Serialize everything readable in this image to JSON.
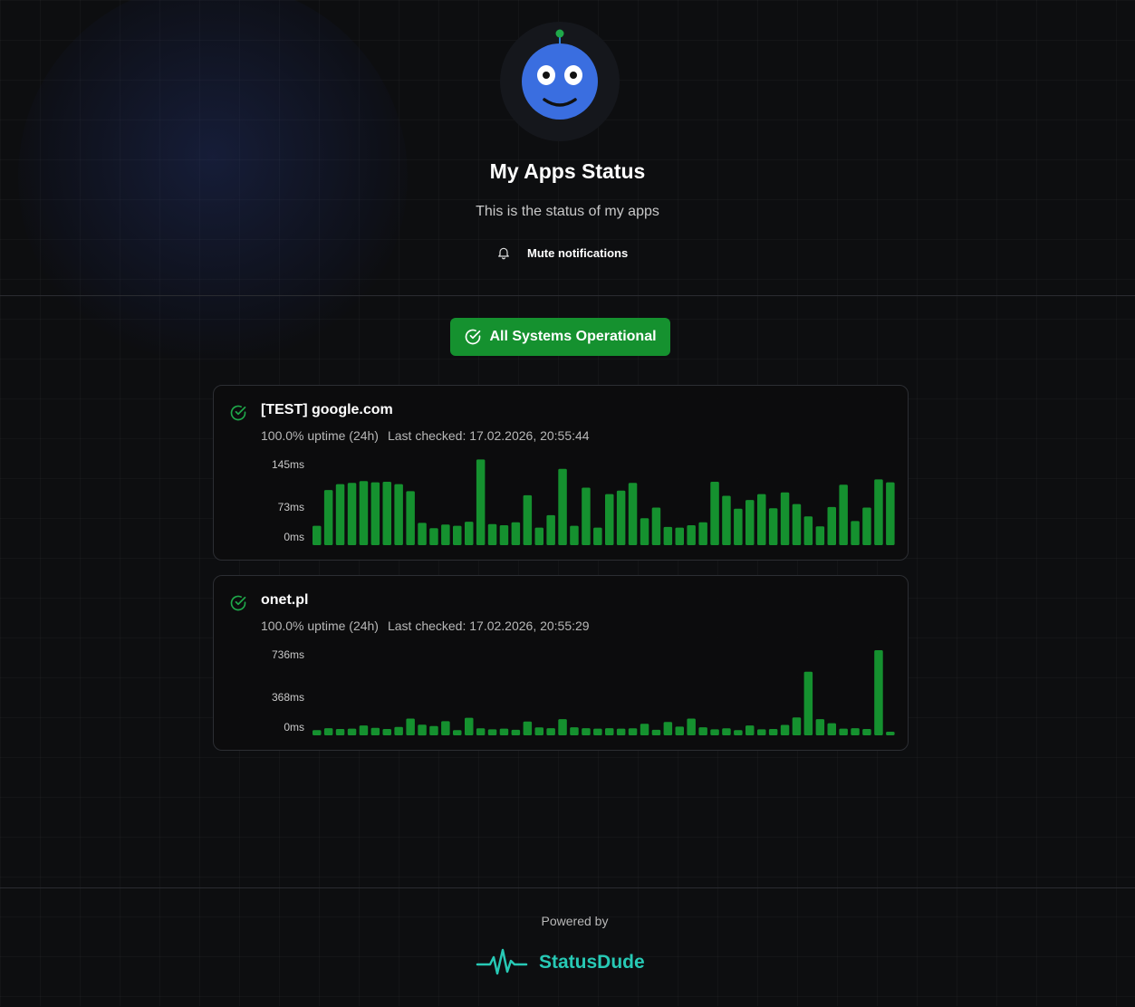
{
  "header": {
    "title": "My Apps Status",
    "subtitle": "This is the status of my apps",
    "mute_label": "Mute notifications"
  },
  "status": {
    "label": "All Systems Operational",
    "color": "#15912f"
  },
  "monitors": [
    {
      "name": "[TEST] google.com",
      "uptime": "100.0% uptime (24h)",
      "last_checked": "Last checked: 17.02.2026, 20:55:44",
      "chart_data": {
        "type": "bar",
        "ylabel_ticks": [
          "145ms",
          "73ms",
          "0ms"
        ],
        "ylim": [
          0,
          145
        ],
        "unit": "ms",
        "color": "#15912f",
        "values": [
          33,
          94,
          104,
          106,
          109,
          107,
          108,
          104,
          92,
          38,
          29,
          35,
          33,
          40,
          146,
          36,
          34,
          39,
          85,
          30,
          51,
          130,
          33,
          98,
          30,
          87,
          93,
          106,
          46,
          64,
          31,
          30,
          34,
          39,
          108,
          84,
          62,
          77,
          87,
          63,
          90,
          70,
          49,
          32,
          65,
          103,
          41,
          64,
          112,
          107
        ]
      }
    },
    {
      "name": "onet.pl",
      "uptime": "100.0% uptime (24h)",
      "last_checked": "Last checked: 17.02.2026, 20:55:29",
      "chart_data": {
        "type": "bar",
        "ylabel_ticks": [
          "736ms",
          "368ms",
          "0ms"
        ],
        "ylim": [
          0,
          736
        ],
        "unit": "ms",
        "color": "#15912f",
        "values": [
          45,
          62,
          55,
          58,
          85,
          65,
          55,
          72,
          145,
          92,
          80,
          122,
          45,
          152,
          60,
          52,
          58,
          48,
          120,
          68,
          62,
          140,
          70,
          62,
          58,
          62,
          58,
          60,
          100,
          48,
          115,
          75,
          145,
          70,
          52,
          60,
          45,
          85,
          52,
          55,
          90,
          155,
          550,
          140,
          105,
          58,
          62,
          55,
          736,
          30
        ]
      }
    }
  ],
  "footer": {
    "powered_by": "Powered by",
    "brand": "StatusDude",
    "brand_color": "#27c9b5"
  }
}
